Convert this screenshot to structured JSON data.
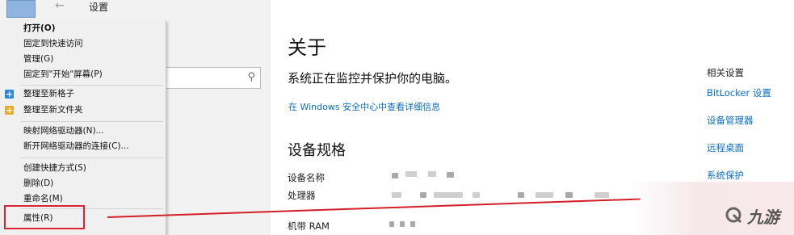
{
  "window": {
    "title": "设置",
    "back_glyph": "←"
  },
  "search": {
    "placeholder": "",
    "icon": "search-icon",
    "glyph": "⚲"
  },
  "context_menu": {
    "items": [
      {
        "label": "打开(O)",
        "bold": true
      },
      {
        "label": "固定到快速访问"
      },
      {
        "label": "管理(G)"
      },
      {
        "label": "固定到\"开始\"屏幕(P)"
      },
      {
        "label": "整理至新格子",
        "icon": "blue"
      },
      {
        "label": "整理至新文件夹",
        "icon": "yellow"
      },
      {
        "label": "映射网络驱动器(N)..."
      },
      {
        "label": "断开网络驱动器的连接(C)..."
      },
      {
        "label": "创建快捷方式(S)"
      },
      {
        "label": "删除(D)"
      },
      {
        "label": "重命名(M)"
      },
      {
        "label": "属性(R)",
        "highlighted": true
      }
    ]
  },
  "about": {
    "title": "关于",
    "status": "系统正在监控并保护你的电脑。",
    "security_link": "在 Windows 安全中心中查看详细信息"
  },
  "specs": {
    "heading": "设备规格",
    "rows": [
      {
        "label": "设备名称"
      },
      {
        "label": "处理器"
      },
      {
        "label": "机带 RAM"
      }
    ]
  },
  "related": {
    "title": "相关设置",
    "links": [
      "BitLocker 设置",
      "设备管理器",
      "远程桌面",
      "系统保护"
    ]
  },
  "watermark": {
    "text": "九游"
  },
  "colors": {
    "highlight": "#d9252f",
    "link": "#0a6cc4",
    "menu_bg": "#f0f0f0"
  }
}
